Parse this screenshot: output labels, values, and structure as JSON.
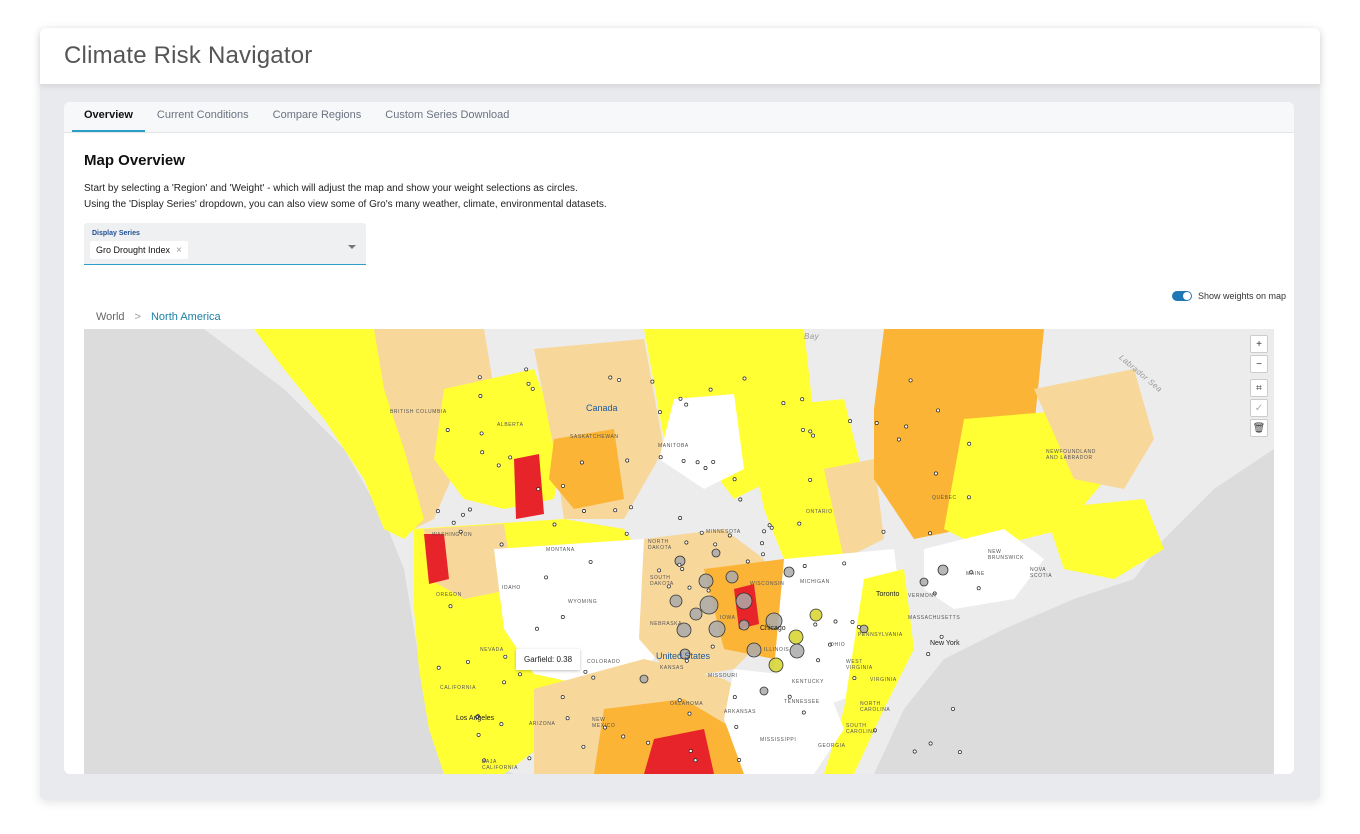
{
  "app": {
    "title": "Climate Risk Navigator"
  },
  "tabs": [
    "Overview",
    "Current Conditions",
    "Compare Regions",
    "Custom Series Download"
  ],
  "section": {
    "title": "Map Overview",
    "desc_line1": "Start by selecting a 'Region' and 'Weight' - which will adjust the map and show your weight selections as circles.",
    "desc_line2": "Using the 'Display Series' dropdown, you can also view some of Gro's many weather, climate, environmental datasets."
  },
  "select": {
    "label": "Display Series",
    "value": "Gro Drought Index",
    "remove_glyph": "×"
  },
  "toggle": {
    "label": "Show weights on map",
    "on": true
  },
  "breadcrumb": {
    "root": "World",
    "separator": ">",
    "current": "North America"
  },
  "map": {
    "controls": {
      "zoom_in": "+",
      "zoom_out": "−",
      "select": "⌗",
      "confirm": "✓",
      "delete": "🗑"
    },
    "tooltip": "Garfield: 0.38",
    "labels": {
      "bay": "Bay",
      "labrador_sea": "Labrador Sea",
      "canada": "Canada",
      "united_states": "United States",
      "british_columbia": "BRITISH COLUMBIA",
      "alberta": "ALBERTA",
      "saskatchewan": "SASKATCHEWAN",
      "manitoba": "MANITOBA",
      "ontario": "ONTARIO",
      "quebec": "QUÉBEC",
      "newfoundland": "NEWFOUNDLAND AND LABRADOR",
      "washington": "WASHINGTON",
      "oregon": "OREGON",
      "idaho": "IDAHO",
      "montana": "MONTANA",
      "wyoming": "WYOMING",
      "nevada": "NEVADA",
      "california": "CALIFORNIA",
      "colorado": "COLORADO",
      "arizona": "ARIZONA",
      "new_mexico": "NEW MEXICO",
      "north_dakota": "NORTH DAKOTA",
      "south_dakota": "SOUTH DAKOTA",
      "nebraska": "NEBRASKA",
      "kansas": "KANSAS",
      "oklahoma": "OKLAHOMA",
      "minnesota": "MINNESOTA",
      "wisconsin": "WISCONSIN",
      "michigan": "MICHIGAN",
      "iowa": "IOWA",
      "illinois": "ILLINOIS",
      "missouri": "MISSOURI",
      "arkansas": "ARKANSAS",
      "mississippi": "MISSISSIPPI",
      "tennessee": "TENNESSEE",
      "kentucky": "KENTUCKY",
      "ohio": "OHIO",
      "pennsylvania": "PENNSYLVANIA",
      "west_virginia": "WEST VIRGINIA",
      "virginia": "VIRGINIA",
      "north_carolina": "NORTH CAROLINA",
      "south_carolina": "SOUTH CAROLINA",
      "georgia": "GEORGIA",
      "vermont": "VERMONT",
      "massachusetts": "MASSACHUSETTS",
      "maine": "MAINE",
      "new_brunswick": "NEW BRUNSWICK",
      "nova_scotia": "NOVA SCOTIA",
      "baja_california": "BAJA CALIFORNIA",
      "toronto": "Toronto",
      "chicago": "Chicago",
      "new_york": "New York",
      "los_angeles": "Los Angeles"
    },
    "colors": {
      "background": "#dcdcdc",
      "no_data": "#ffffff",
      "low": "#ffff33",
      "mild": "#f7d79a",
      "moderate": "#fbb436",
      "high": "#f28c28",
      "severe": "#e8242b",
      "circle_fill": "#aaaaaa",
      "circle_fill_yellow": "#d6d42a"
    }
  }
}
